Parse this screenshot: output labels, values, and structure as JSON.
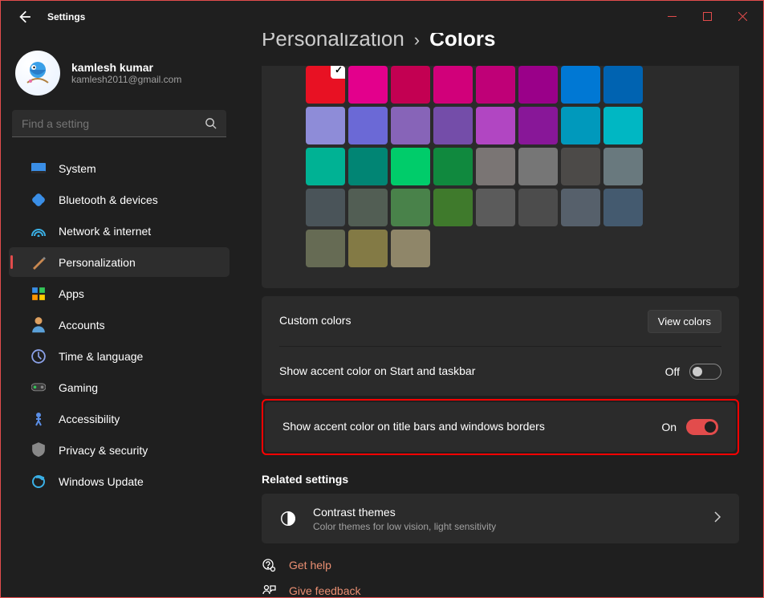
{
  "title": "Settings",
  "user": {
    "name": "kamlesh kumar",
    "email": "kamlesh2011@gmail.com"
  },
  "search": {
    "placeholder": "Find a setting"
  },
  "nav": [
    {
      "label": "System"
    },
    {
      "label": "Bluetooth & devices"
    },
    {
      "label": "Network & internet"
    },
    {
      "label": "Personalization"
    },
    {
      "label": "Apps"
    },
    {
      "label": "Accounts"
    },
    {
      "label": "Time & language"
    },
    {
      "label": "Gaming"
    },
    {
      "label": "Accessibility"
    },
    {
      "label": "Privacy & security"
    },
    {
      "label": "Windows Update"
    }
  ],
  "breadcrumb": {
    "parent": "Personalization",
    "current": "Colors"
  },
  "palette": {
    "selected_index": 0,
    "rows": [
      [
        "#e81123",
        "#e3008c",
        "#c30052",
        "#bf0077",
        "#bf0077",
        "#9a0089",
        "#0078d4",
        "#0063b1"
      ],
      [
        "#8e8cd8",
        "#6b69d6",
        "#8764b8",
        "#744da9",
        "#b146c2",
        "#881798",
        "#038387",
        "#00b7c3"
      ],
      [
        "#00b294",
        "#018574",
        "#00cc6a",
        "#10893e",
        "#7a7574",
        "#767676",
        "#4c4a48",
        "#69797e"
      ],
      [
        "#4a5459",
        "#647c64",
        "#525e54",
        "#847545",
        "#7a7574",
        "#767676",
        "#4c4a48",
        "#69797e"
      ],
      [
        "#4a5459",
        "#647c64",
        "#525e54",
        "#847545",
        "#7e735f",
        "",
        "",
        ""
      ]
    ],
    "last_row": [
      "#666b54",
      "#7e735f",
      "#8f8669"
    ]
  },
  "custom": {
    "label": "Custom colors",
    "button": "View colors"
  },
  "accent_taskbar": {
    "label": "Show accent color on Start and taskbar",
    "state": "Off"
  },
  "accent_title": {
    "label": "Show accent color on title bars and windows borders",
    "state": "On"
  },
  "related": {
    "heading": "Related settings",
    "contrast_title": "Contrast themes",
    "contrast_sub": "Color themes for low vision, light sensitivity"
  },
  "links": {
    "help": "Get help",
    "feedback": "Give feedback"
  }
}
